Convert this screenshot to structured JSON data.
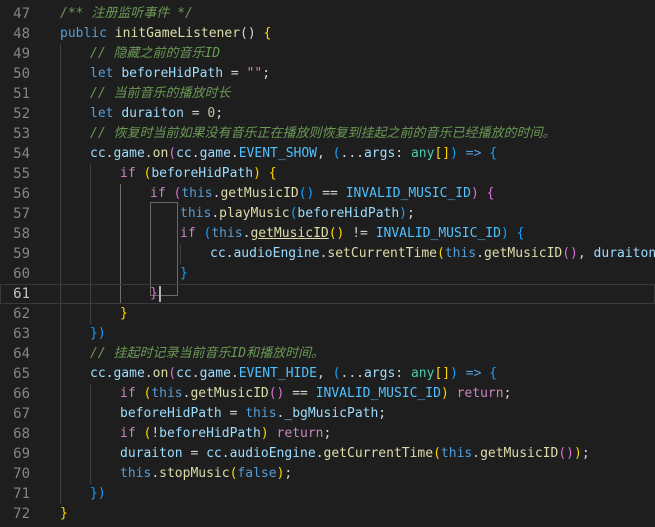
{
  "editor": {
    "current_line": 61,
    "lines": [
      {
        "n": "47",
        "indent": 1,
        "tokens": [
          [
            "cmt",
            "/** 注册监听事件 */"
          ]
        ]
      },
      {
        "n": "48",
        "indent": 1,
        "tokens": [
          [
            "kw",
            "public "
          ],
          [
            "fn",
            "initGameListener"
          ],
          [
            "punc",
            "() "
          ],
          [
            "brace",
            "{"
          ]
        ]
      },
      {
        "n": "49",
        "indent": 2,
        "tokens": [
          [
            "cmt",
            "// 隐藏之前的音乐ID"
          ]
        ]
      },
      {
        "n": "50",
        "indent": 2,
        "tokens": [
          [
            "kw",
            "let "
          ],
          [
            "var",
            "beforeHidPath"
          ],
          [
            "punc",
            " = "
          ],
          [
            "str",
            "\"\""
          ],
          [
            "punc",
            ";"
          ]
        ]
      },
      {
        "n": "51",
        "indent": 2,
        "tokens": [
          [
            "cmt",
            "// 当前音乐的播放时长"
          ]
        ]
      },
      {
        "n": "52",
        "indent": 2,
        "tokens": [
          [
            "kw",
            "let "
          ],
          [
            "var",
            "duraiton"
          ],
          [
            "punc",
            " = "
          ],
          [
            "num",
            "0"
          ],
          [
            "punc",
            ";"
          ]
        ]
      },
      {
        "n": "53",
        "indent": 2,
        "tokens": [
          [
            "cmt",
            "// 恢复时当前如果没有音乐正在播放则恢复到挂起之前的音乐已经播放的时间。"
          ]
        ]
      },
      {
        "n": "54",
        "indent": 2,
        "tokens": [
          [
            "var",
            "cc"
          ],
          [
            "punc",
            "."
          ],
          [
            "var",
            "game"
          ],
          [
            "punc",
            "."
          ],
          [
            "fn",
            "on"
          ],
          [
            "brace2",
            "("
          ],
          [
            "var",
            "cc"
          ],
          [
            "punc",
            "."
          ],
          [
            "var",
            "game"
          ],
          [
            "punc",
            "."
          ],
          [
            "const",
            "EVENT_SHOW"
          ],
          [
            "punc",
            ", "
          ],
          [
            "brace3",
            "("
          ],
          [
            "punc",
            "..."
          ],
          [
            "var",
            "args"
          ],
          [
            "punc",
            ": "
          ],
          [
            "type",
            "any"
          ],
          [
            "brace",
            "[]"
          ],
          [
            "brace3",
            ")"
          ],
          [
            "punc",
            " "
          ],
          [
            "kw",
            "=>"
          ],
          [
            "punc",
            " "
          ],
          [
            "brace3",
            "{"
          ]
        ]
      },
      {
        "n": "55",
        "indent": 3,
        "tokens": [
          [
            "ctrl",
            "if "
          ],
          [
            "brace",
            "("
          ],
          [
            "var",
            "beforeHidPath"
          ],
          [
            "brace",
            ")"
          ],
          [
            "punc",
            " "
          ],
          [
            "brace",
            "{"
          ]
        ]
      },
      {
        "n": "56",
        "indent": 4,
        "tokens": [
          [
            "ctrl",
            "if "
          ],
          [
            "brace2",
            "("
          ],
          [
            "kw",
            "this"
          ],
          [
            "punc",
            "."
          ],
          [
            "fn",
            "getMusicID"
          ],
          [
            "brace3",
            "()"
          ],
          [
            "punc",
            " == "
          ],
          [
            "const",
            "INVALID_MUSIC_ID"
          ],
          [
            "brace2",
            ")"
          ],
          [
            "punc",
            " "
          ],
          [
            "brace2",
            "{"
          ]
        ]
      },
      {
        "n": "57",
        "indent": 5,
        "tokens": [
          [
            "kw",
            "this"
          ],
          [
            "punc",
            "."
          ],
          [
            "fn",
            "playMusic"
          ],
          [
            "brace3",
            "("
          ],
          [
            "var",
            "beforeHidPath"
          ],
          [
            "brace3",
            ")"
          ],
          [
            "punc",
            ";"
          ]
        ]
      },
      {
        "n": "58",
        "indent": 5,
        "tokens": [
          [
            "ctrl",
            "if "
          ],
          [
            "brace3",
            "("
          ],
          [
            "kw",
            "this"
          ],
          [
            "punc",
            "."
          ],
          [
            "link",
            "getMusicID"
          ],
          [
            "brace",
            "()"
          ],
          [
            "punc",
            " != "
          ],
          [
            "const",
            "INVALID_MUSIC_ID"
          ],
          [
            "brace3",
            ")"
          ],
          [
            "punc",
            " "
          ],
          [
            "brace3",
            "{"
          ]
        ]
      },
      {
        "n": "59",
        "indent": 6,
        "tokens": [
          [
            "var",
            "cc"
          ],
          [
            "punc",
            "."
          ],
          [
            "var",
            "audioEngine"
          ],
          [
            "punc",
            "."
          ],
          [
            "fn",
            "setCurrentTime"
          ],
          [
            "brace",
            "("
          ],
          [
            "kw",
            "this"
          ],
          [
            "punc",
            "."
          ],
          [
            "fn",
            "getMusicID"
          ],
          [
            "brace2",
            "()"
          ],
          [
            "punc",
            ", "
          ],
          [
            "var",
            "duraiton"
          ],
          [
            "brace",
            ")"
          ],
          [
            "punc",
            ";"
          ]
        ]
      },
      {
        "n": "60",
        "indent": 5,
        "tokens": [
          [
            "brace3",
            "}"
          ]
        ]
      },
      {
        "n": "61",
        "indent": 4,
        "tokens": [
          [
            "brace2",
            "}"
          ]
        ]
      },
      {
        "n": "62",
        "indent": 3,
        "tokens": [
          [
            "brace",
            "}"
          ]
        ]
      },
      {
        "n": "63",
        "indent": 2,
        "tokens": [
          [
            "brace3",
            "})"
          ]
        ]
      },
      {
        "n": "64",
        "indent": 2,
        "tokens": [
          [
            "cmt",
            "// 挂起时记录当前音乐ID和播放时间。"
          ]
        ]
      },
      {
        "n": "65",
        "indent": 2,
        "tokens": [
          [
            "var",
            "cc"
          ],
          [
            "punc",
            "."
          ],
          [
            "var",
            "game"
          ],
          [
            "punc",
            "."
          ],
          [
            "fn",
            "on"
          ],
          [
            "brace2",
            "("
          ],
          [
            "var",
            "cc"
          ],
          [
            "punc",
            "."
          ],
          [
            "var",
            "game"
          ],
          [
            "punc",
            "."
          ],
          [
            "const",
            "EVENT_HIDE"
          ],
          [
            "punc",
            ", "
          ],
          [
            "brace3",
            "("
          ],
          [
            "punc",
            "..."
          ],
          [
            "var",
            "args"
          ],
          [
            "punc",
            ": "
          ],
          [
            "type",
            "any"
          ],
          [
            "brace",
            "[]"
          ],
          [
            "brace3",
            ")"
          ],
          [
            "punc",
            " "
          ],
          [
            "kw",
            "=>"
          ],
          [
            "punc",
            " "
          ],
          [
            "brace3",
            "{"
          ]
        ]
      },
      {
        "n": "66",
        "indent": 3,
        "tokens": [
          [
            "ctrl",
            "if "
          ],
          [
            "brace",
            "("
          ],
          [
            "kw",
            "this"
          ],
          [
            "punc",
            "."
          ],
          [
            "fn",
            "getMusicID"
          ],
          [
            "brace2",
            "()"
          ],
          [
            "punc",
            " == "
          ],
          [
            "const",
            "INVALID_MUSIC_ID"
          ],
          [
            "brace",
            ")"
          ],
          [
            "punc",
            " "
          ],
          [
            "ctrl",
            "return"
          ],
          [
            "punc",
            ";"
          ]
        ]
      },
      {
        "n": "67",
        "indent": 3,
        "tokens": [
          [
            "var",
            "beforeHidPath"
          ],
          [
            "punc",
            " = "
          ],
          [
            "kw",
            "this"
          ],
          [
            "punc",
            "."
          ],
          [
            "var",
            "_bgMusicPath"
          ],
          [
            "punc",
            ";"
          ]
        ]
      },
      {
        "n": "68",
        "indent": 3,
        "tokens": [
          [
            "ctrl",
            "if "
          ],
          [
            "brace",
            "("
          ],
          [
            "punc",
            "!"
          ],
          [
            "var",
            "beforeHidPath"
          ],
          [
            "brace",
            ")"
          ],
          [
            "punc",
            " "
          ],
          [
            "ctrl",
            "return"
          ],
          [
            "punc",
            ";"
          ]
        ]
      },
      {
        "n": "69",
        "indent": 3,
        "tokens": [
          [
            "var",
            "duraiton"
          ],
          [
            "punc",
            " = "
          ],
          [
            "var",
            "cc"
          ],
          [
            "punc",
            "."
          ],
          [
            "var",
            "audioEngine"
          ],
          [
            "punc",
            "."
          ],
          [
            "fn",
            "getCurrentTime"
          ],
          [
            "brace",
            "("
          ],
          [
            "kw",
            "this"
          ],
          [
            "punc",
            "."
          ],
          [
            "fn",
            "getMusicID"
          ],
          [
            "brace2",
            "()"
          ],
          [
            "brace",
            ")"
          ],
          [
            "punc",
            ";"
          ]
        ]
      },
      {
        "n": "70",
        "indent": 3,
        "tokens": [
          [
            "kw",
            "this"
          ],
          [
            "punc",
            "."
          ],
          [
            "fn",
            "stopMusic"
          ],
          [
            "brace",
            "("
          ],
          [
            "kw",
            "false"
          ],
          [
            "brace",
            ")"
          ],
          [
            "punc",
            ";"
          ]
        ]
      },
      {
        "n": "71",
        "indent": 2,
        "tokens": [
          [
            "brace3",
            "})"
          ]
        ]
      },
      {
        "n": "72",
        "indent": 1,
        "tokens": [
          [
            "brace",
            "}"
          ]
        ]
      }
    ]
  }
}
